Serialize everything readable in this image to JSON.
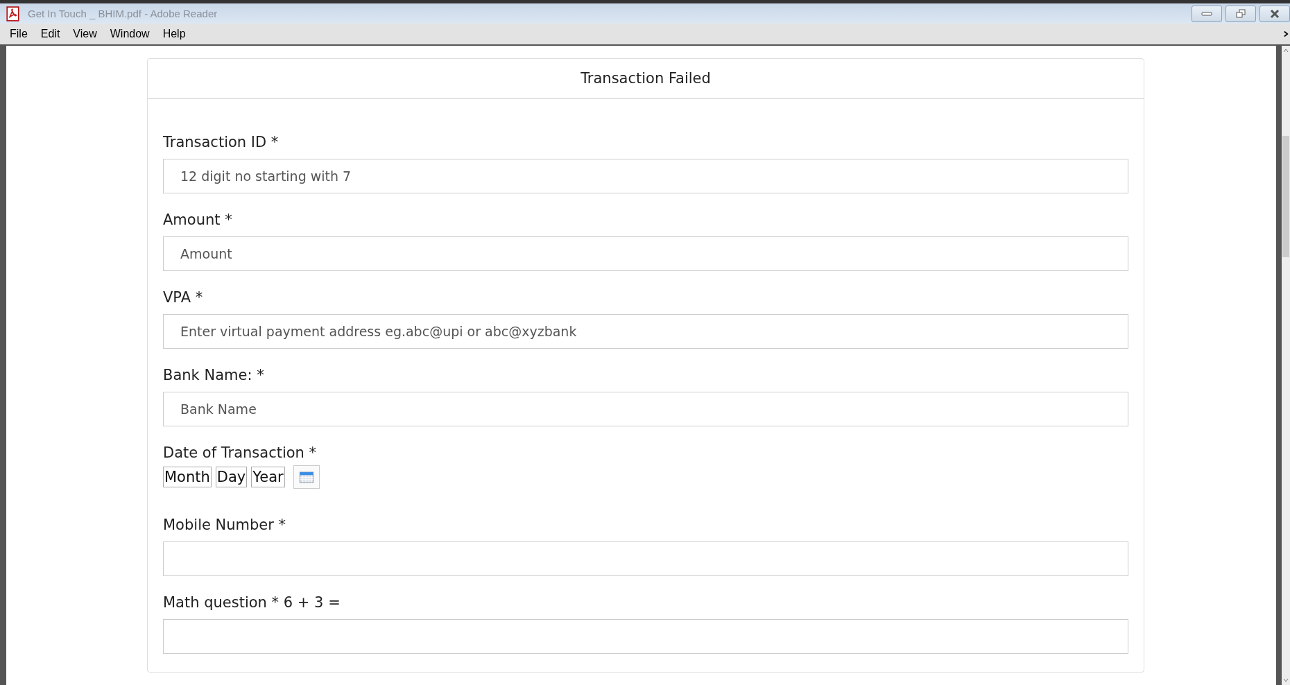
{
  "window": {
    "title": "Get In Touch _ BHIM.pdf - Adobe Reader"
  },
  "menu": [
    "File",
    "Edit",
    "View",
    "Window",
    "Help"
  ],
  "form": {
    "title": "Transaction Failed",
    "fields": [
      {
        "kind": "text",
        "label": "Transaction ID *",
        "placeholder": "12 digit no starting with 7"
      },
      {
        "kind": "text",
        "label": "Amount *",
        "placeholder": "Amount"
      },
      {
        "kind": "text",
        "label": "VPA *",
        "placeholder": "Enter virtual payment address eg.abc@upi or abc@xyzbank"
      },
      {
        "kind": "text",
        "label": "Bank Name: *",
        "placeholder": "Bank Name"
      },
      {
        "kind": "date",
        "label": "Date of Transaction *",
        "parts": [
          "Month",
          "Day",
          "Year"
        ]
      },
      {
        "kind": "text",
        "label": "Mobile Number *"
      },
      {
        "kind": "text",
        "label": "Math question * 6 + 3 ="
      }
    ]
  }
}
